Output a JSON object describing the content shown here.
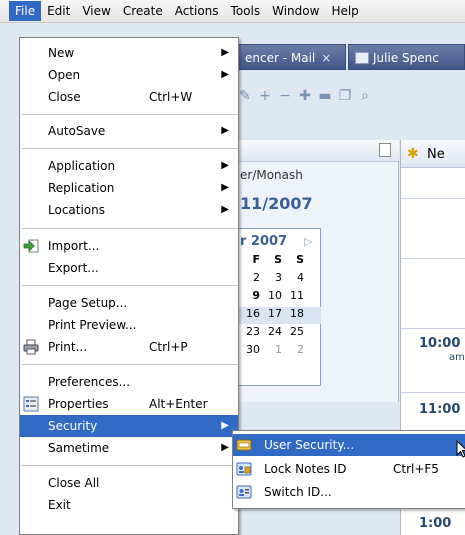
{
  "menubar": {
    "items": [
      {
        "label": "File",
        "active": true
      },
      {
        "label": "Edit"
      },
      {
        "label": "View"
      },
      {
        "label": "Create"
      },
      {
        "label": "Actions"
      },
      {
        "label": "Tools"
      },
      {
        "label": "Window"
      },
      {
        "label": "Help"
      }
    ]
  },
  "background": {
    "tabs": [
      {
        "label": "encer - Mail",
        "close": "×"
      },
      {
        "label": "Julie Spenc"
      }
    ],
    "calendar": {
      "path": "er/Monash",
      "date": "11/2007",
      "month": "r 2007",
      "day_headers": [
        "F",
        "S",
        "S"
      ],
      "rows": [
        [
          "2",
          "3",
          "4"
        ],
        [
          "9",
          "10",
          "11"
        ],
        [
          "16",
          "17",
          "18"
        ],
        [
          "23",
          "24",
          "25"
        ],
        [
          "30",
          "1",
          "2"
        ]
      ]
    },
    "right_panel": {
      "new_label": "Ne",
      "times": [
        {
          "time": "10:00",
          "ampm": "am"
        },
        {
          "time": "11:00",
          "ampm": ""
        },
        {
          "time": "1:00",
          "ampm": ""
        }
      ]
    }
  },
  "file_menu": {
    "new": "New",
    "open": "Open",
    "close": "Close",
    "close_shortcut": "Ctrl+W",
    "autosave": "AutoSave",
    "application": "Application",
    "replication": "Replication",
    "locations": "Locations",
    "import": "Import...",
    "export": "Export...",
    "page_setup": "Page Setup...",
    "print_preview": "Print Preview...",
    "print": "Print...",
    "print_shortcut": "Ctrl+P",
    "preferences": "Preferences...",
    "properties": "Properties",
    "properties_shortcut": "Alt+Enter",
    "security": "Security",
    "sametime": "Sametime",
    "close_all": "Close All",
    "exit": "Exit"
  },
  "security_submenu": {
    "user_security": "User Security...",
    "lock_notes_id": "Lock Notes ID",
    "lock_shortcut": "Ctrl+F5",
    "switch_id": "Switch ID..."
  },
  "colors": {
    "highlight": "#316ac5",
    "calendar_blue": "#3a5f95"
  }
}
